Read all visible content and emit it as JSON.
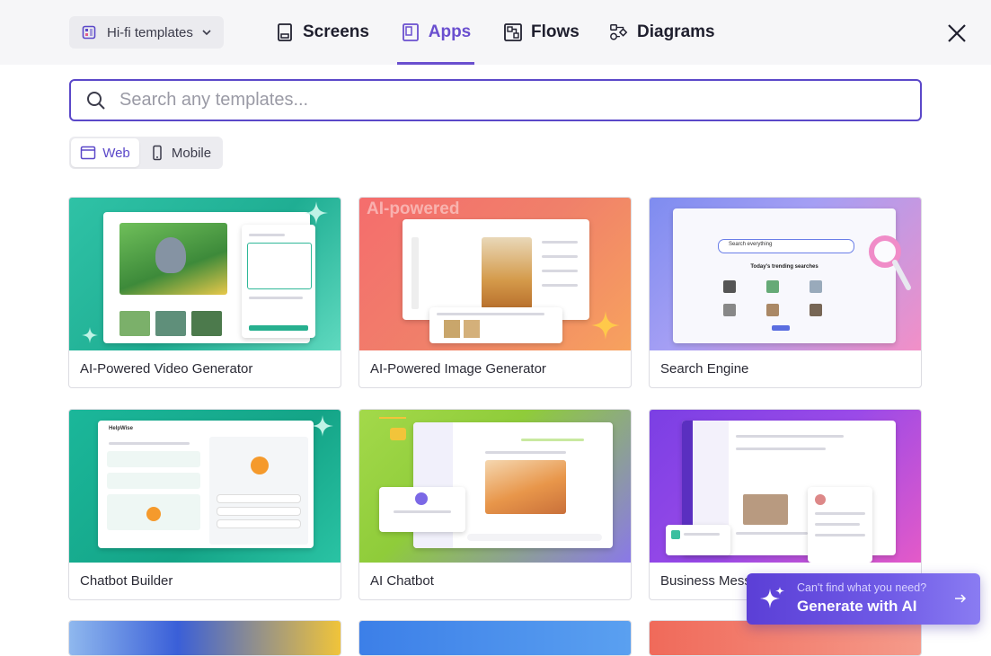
{
  "header": {
    "template_select": {
      "label": "Hi-fi templates",
      "icon": "layout-icon"
    },
    "tabs": [
      {
        "label": "Screens",
        "icon": "screen-icon"
      },
      {
        "label": "Apps",
        "icon": "apps-icon",
        "active": true
      },
      {
        "label": "Flows",
        "icon": "flows-icon"
      },
      {
        "label": "Diagrams",
        "icon": "diagrams-icon"
      }
    ],
    "close_icon": "close-icon"
  },
  "search": {
    "placeholder": "Search any templates...",
    "value": ""
  },
  "platform_toggle": {
    "options": [
      {
        "label": "Web",
        "icon": "browser-icon",
        "active": true
      },
      {
        "label": "Mobile",
        "icon": "phone-icon",
        "active": false
      }
    ]
  },
  "cards": [
    {
      "title": "AI-Powered Video Generator"
    },
    {
      "title": "AI-Powered Image Generator",
      "thumb_text": "AI-powered"
    },
    {
      "title": "Search Engine",
      "thumb_text": "Search everything",
      "thumb_sub": "Today's trending searches"
    },
    {
      "title": "Chatbot Builder",
      "thumb_text": "HelpWise"
    },
    {
      "title": "AI Chatbot"
    },
    {
      "title": "Business Messenger"
    }
  ],
  "generate_ai": {
    "subtitle": "Can't find what you need?",
    "label": "Generate with AI",
    "icon": "sparkle-icon",
    "arrow_icon": "arrow-right-icon"
  },
  "colors": {
    "accent": "#6a4fcf",
    "search_border": "#5b48c9",
    "header_bg": "#f6f6f8"
  }
}
